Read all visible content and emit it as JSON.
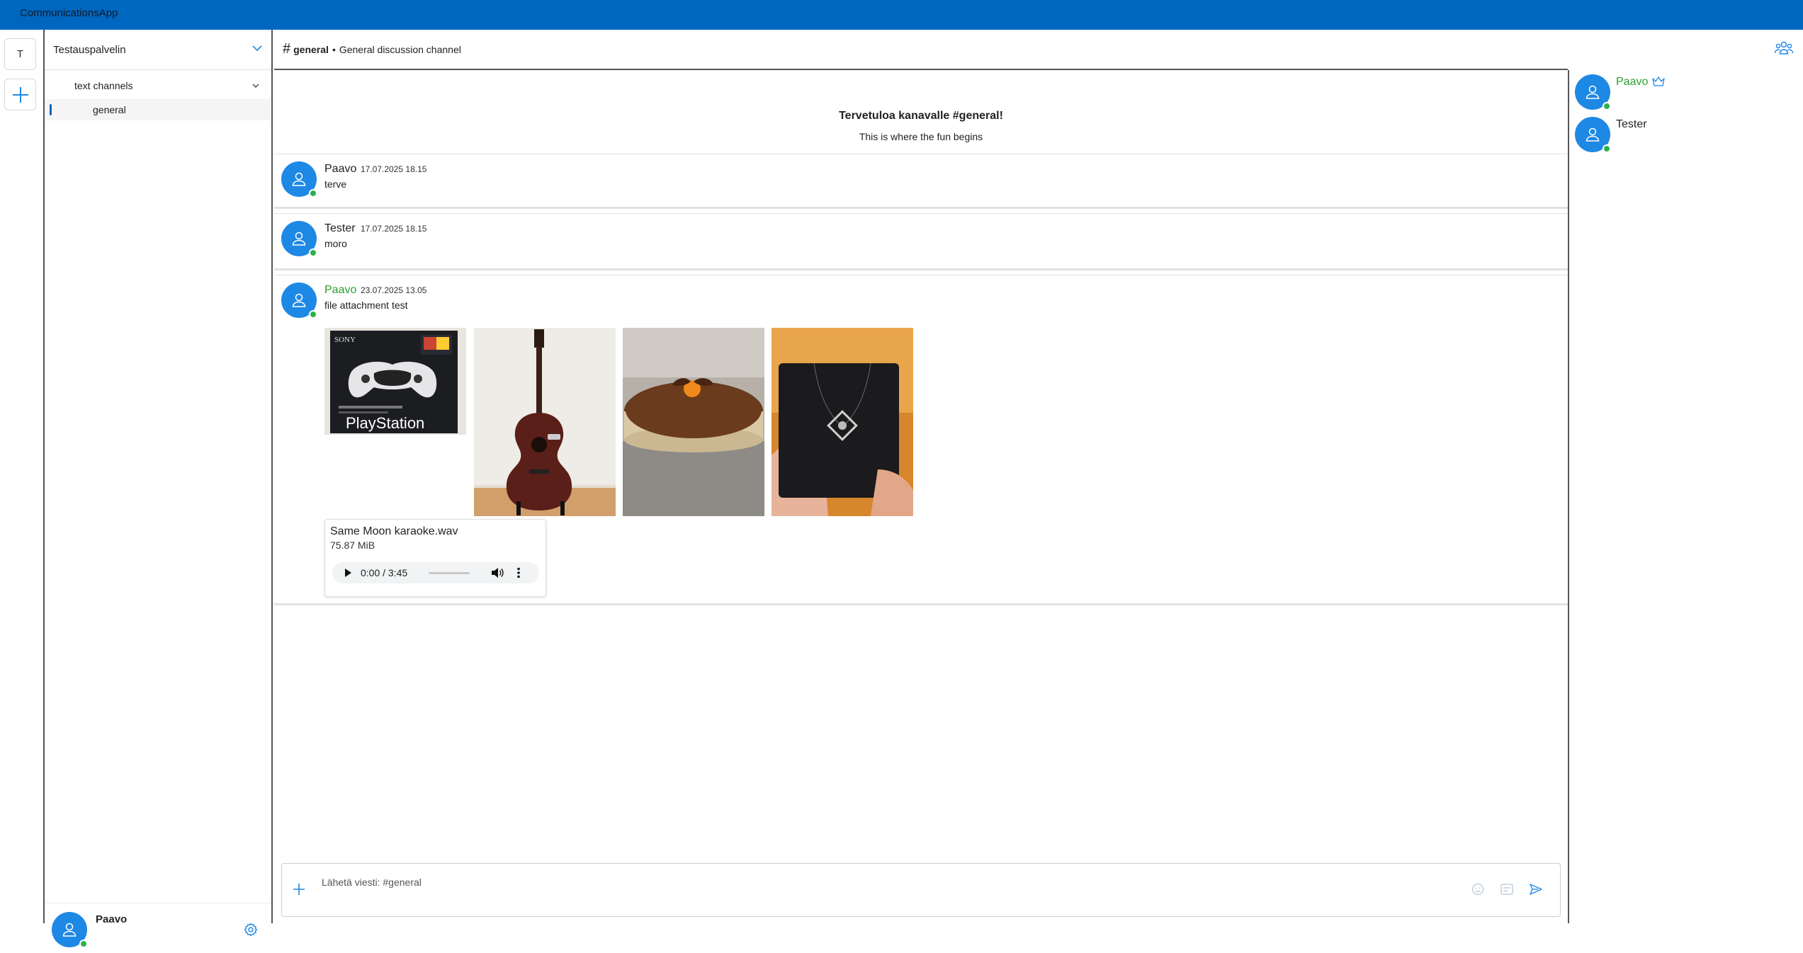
{
  "app": {
    "title": "CommunicationsApp"
  },
  "rail": {
    "server_initial": "T",
    "add_icon": "plus-icon"
  },
  "sidebar": {
    "server_name": "Testauspalvelin",
    "category": "text channels",
    "channels": [
      {
        "label": "general",
        "active": true
      }
    ],
    "user": {
      "name": "Paavo",
      "status": "online",
      "settings_icon": "gear-icon"
    }
  },
  "channel": {
    "hash": "#",
    "name": "general",
    "separator": "•",
    "description": "General discussion channel"
  },
  "welcome": {
    "title": "Tervetuloa kanavalle #general!",
    "subtitle": "This is where the fun begins"
  },
  "messages": [
    {
      "author": "Paavo",
      "time": "17.07.2025 18.15",
      "text": "terve",
      "author_color": "#222222"
    },
    {
      "author": "Tester",
      "time": "17.07.2025 18.15",
      "text": "moro",
      "author_color": "#222222"
    },
    {
      "author": "Paavo",
      "time": "23.07.2025 13.05",
      "text": "file attachment test",
      "author_color": "#2e9e2e",
      "attachments": [
        {
          "kind": "image",
          "subject": "playstation-controller-box",
          "box_text": "PlayStation",
          "brand_text": "SONY"
        },
        {
          "kind": "image",
          "subject": "acoustic-guitar"
        },
        {
          "kind": "image",
          "subject": "chocolate-cake"
        },
        {
          "kind": "image",
          "subject": "pendant-necklace-box"
        }
      ],
      "audio": {
        "filename": "Same Moon karaoke.wav",
        "size": "75.87 MiB",
        "time": "0:00 / 3:45",
        "progress": 0
      }
    }
  ],
  "composer": {
    "placeholder": "Lähetä viesti: #general"
  },
  "members": [
    {
      "name": "Paavo",
      "status": "online",
      "owner": true,
      "color": "#2e9e2e"
    },
    {
      "name": "Tester",
      "status": "online",
      "owner": false,
      "color": "#222222"
    }
  ],
  "colors": {
    "accent": "#0067c0",
    "avatar": "#1e88e5",
    "online": "#2db14a",
    "owner_name": "#2e9e2e"
  }
}
